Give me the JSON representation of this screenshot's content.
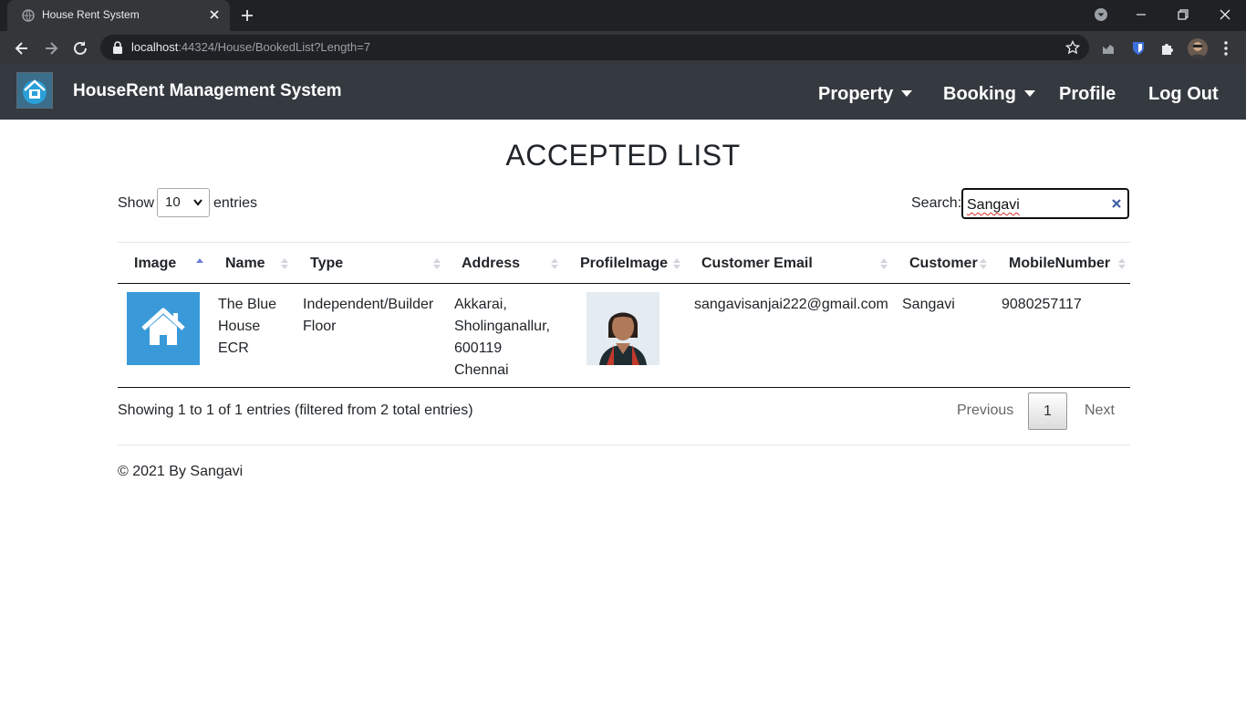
{
  "browser": {
    "tab_title": "House Rent System",
    "url_host": "localhost",
    "url_path": ":44324/House/BookedList?Length=7"
  },
  "navbar": {
    "brand": "HouseRent Management System",
    "items": [
      {
        "label": "Property",
        "dropdown": true
      },
      {
        "label": "Booking",
        "dropdown": true
      },
      {
        "label": "Profile",
        "dropdown": false
      },
      {
        "label": "Log Out",
        "dropdown": false
      }
    ]
  },
  "page": {
    "title": "ACCEPTED LIST"
  },
  "table_controls": {
    "show_label": "Show",
    "length_value": "10",
    "entries_label": "entries",
    "search_label": "Search:",
    "search_value": "Sangavi"
  },
  "table": {
    "columns": [
      "Image",
      "Name",
      "Type",
      "Address",
      "ProfileImage",
      "Customer Email",
      "Customer",
      "MobileNumber"
    ],
    "sorted_column": "Image",
    "rows": [
      {
        "name": [
          "The Blue",
          "House",
          "ECR"
        ],
        "type": [
          "Independent/Builder",
          "Floor"
        ],
        "address": [
          "Akkarai,",
          "Sholinganallur,",
          "600119",
          "Chennai"
        ],
        "customer_email": "sangavisanjai222@gmail.com",
        "customer": "Sangavi",
        "mobile": "9080257117"
      }
    ]
  },
  "pagination": {
    "info": "Showing 1 to 1 of 1 entries (filtered from 2 total entries)",
    "previous": "Previous",
    "current": "1",
    "next": "Next"
  },
  "footer": {
    "text": "© 2021 By Sangavi"
  },
  "colors": {
    "navbar_bg": "#343a40",
    "browser_bg": "#202124",
    "house_tile": "#3a9ad9",
    "sort_active": "#6f7fd6"
  }
}
